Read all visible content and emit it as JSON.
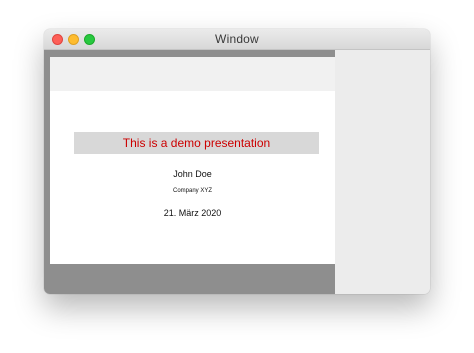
{
  "window": {
    "title": "Window"
  },
  "slide": {
    "title": "This is a demo presentation",
    "author": "John Doe",
    "institute": "Company XYZ",
    "date": "21. März 2020"
  },
  "colors": {
    "title_text": "#cc0000",
    "title_box": "#d8d8d8",
    "slide_frame": "#8e8e8e",
    "window_background": "#ececec"
  },
  "icons": {
    "close": "close-traffic-light-icon",
    "minimize": "minimize-traffic-light-icon",
    "maximize": "maximize-traffic-light-icon"
  }
}
